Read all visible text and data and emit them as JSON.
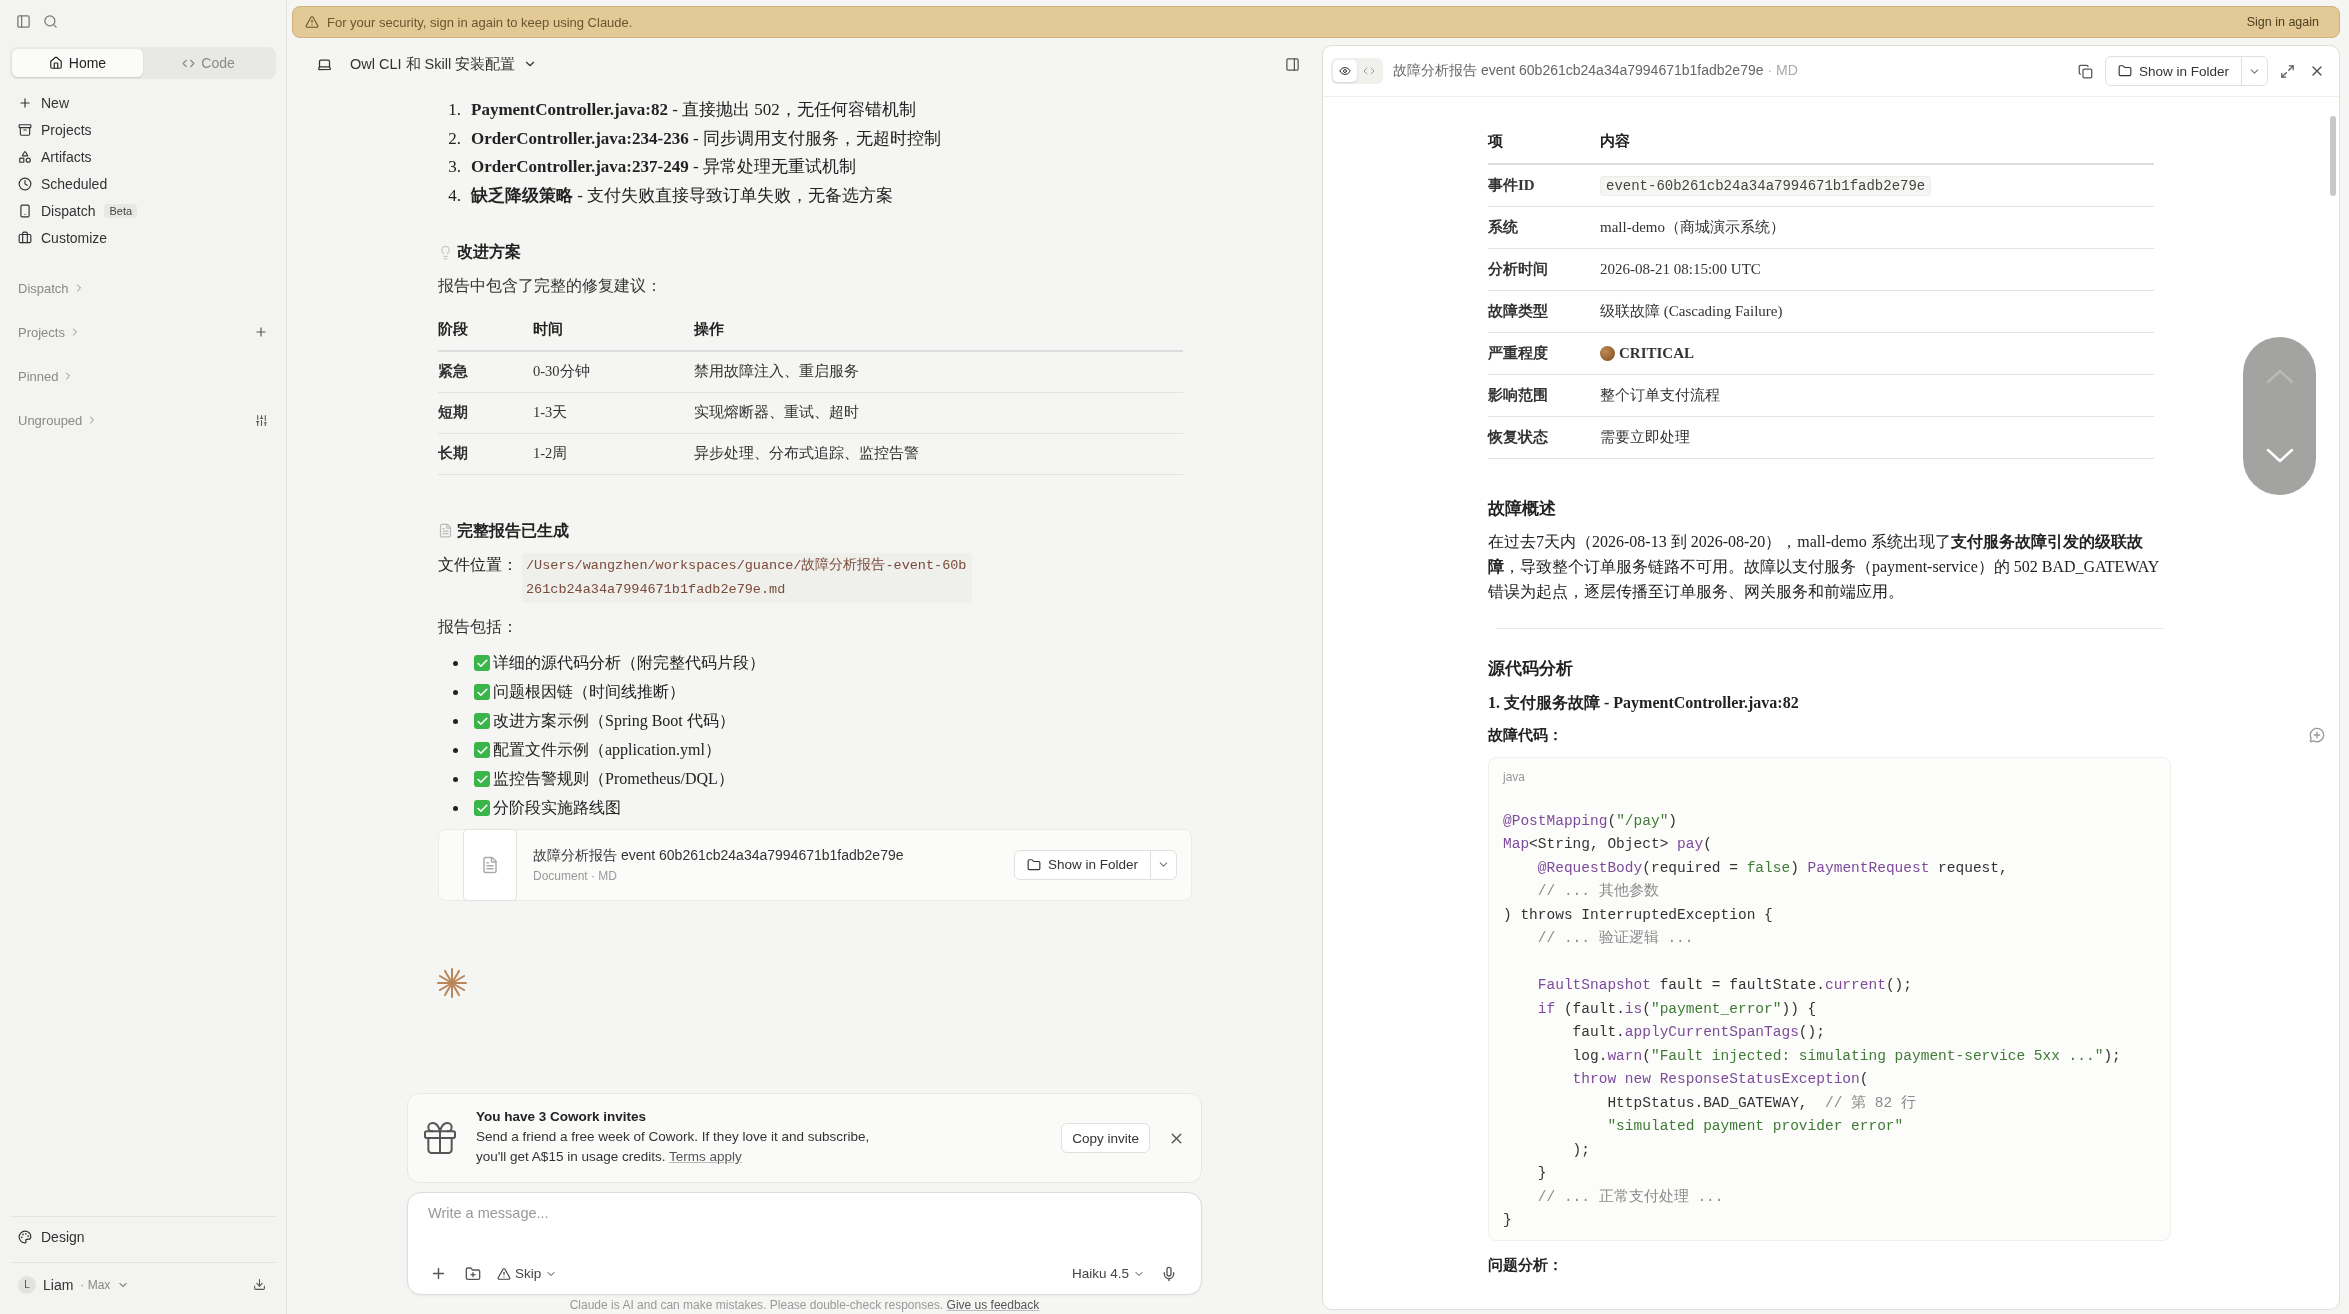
{
  "sidebar": {
    "tabs": [
      {
        "label": "Home",
        "selected": true
      },
      {
        "label": "Code",
        "selected": false
      }
    ],
    "nav": [
      {
        "label": "New"
      },
      {
        "label": "Projects"
      },
      {
        "label": "Artifacts"
      },
      {
        "label": "Scheduled"
      },
      {
        "label": "Dispatch",
        "badge": "Beta"
      },
      {
        "label": "Customize"
      }
    ],
    "sections": [
      {
        "label": "Dispatch",
        "kind": "plain"
      },
      {
        "label": "Projects",
        "kind": "add"
      },
      {
        "label": "Pinned",
        "kind": "plain"
      },
      {
        "label": "Ungrouped",
        "kind": "filter"
      }
    ],
    "bottom": {
      "label": "Design"
    },
    "account": {
      "initial": "L",
      "name": "Liam",
      "plan": "· Max"
    }
  },
  "banner": {
    "message": "For your security, sign in again to keep using Claude.",
    "action": "Sign in again"
  },
  "chat": {
    "title": "Owl CLI 和 Skill 安装配置",
    "issues": [
      {
        "number": "1.",
        "text": "**PaymentController.java:82** - 直接抛出 502，无任何容错机制"
      },
      {
        "number": "2.",
        "text": "**OrderController.java:234-236** - 同步调用支付服务，无超时控制"
      },
      {
        "number": "3.",
        "text": "**OrderController.java:237-249** - 异常处理无重试机制"
      },
      {
        "number": "4.",
        "text": "**缺乏降级策略** - 支付失败直接导致订单失败，无备选方案"
      }
    ],
    "plan_heading": "改进方案",
    "plan_intro": "报告中包含了完整的修复建议：",
    "plan_table": {
      "columns": [
        "阶段",
        "时间",
        "操作"
      ],
      "rows": [
        [
          "紧急",
          "0-30分钟",
          "禁用故障注入、重启服务"
        ],
        [
          "短期",
          "1-3天",
          "实现熔断器、重试、超时"
        ],
        [
          "长期",
          "1-2周",
          "异步处理、分布式追踪、监控告警"
        ]
      ]
    },
    "report_heading": "完整报告已生成",
    "file_label": "文件位置：",
    "file_path": "/Users/wangzhen/workspaces/guance/故障分析报告-event-60b261cb24a34a7994671b1fadb2e79e.md",
    "includes_label": "报告包括：",
    "includes": [
      {
        "text": "详细的源代码分析（附完整代码片段）",
        "checked": true
      },
      {
        "text": "问题根因链（时间线推断）",
        "checked": true
      },
      {
        "text": "改进方案示例（Spring Boot 代码）",
        "checked": true
      },
      {
        "text": "配置文件示例（application.yml）",
        "checked": true
      },
      {
        "text": "监控告警规则（Prometheus/DQL）",
        "checked": true
      },
      {
        "text": "分阶段实施路线图",
        "checked": true
      }
    ],
    "attachment": {
      "title": "故障分析报告 event 60b261cb24a34a7994671b1fadb2e79e",
      "subtitle": "Document · MD",
      "button": "Show in Folder"
    },
    "invite": {
      "title": "You have 3 Cowork invites",
      "text": "Send a friend a free week of Cowork. If they love it and subscribe, you'll get A$15 in usage credits.",
      "link": "Terms apply",
      "button": "Copy invite"
    },
    "composer": {
      "placeholder": "Write a message...",
      "mode": "Skip",
      "model": "Haiku 4.5"
    },
    "disclaimer": {
      "text": "Claude is AI and can make mistakes. Please double-check responses.",
      "link": "Give us feedback"
    }
  },
  "document": {
    "view_modes": [
      {
        "selected": true
      },
      {
        "selected": false
      }
    ],
    "title": "故障分析报告 event 60b261cb24a34a7994671b1fadb2e79e",
    "format": "· MD",
    "button": "Show in Folder",
    "info_table": {
      "columns": [
        "项",
        "内容"
      ],
      "rows": [
        {
          "item": "事件ID",
          "value": "event-60b261cb24a34a7994671b1fadb2e79e",
          "kind": "code"
        },
        {
          "item": "系统",
          "value": "mall-demo（商城演示系统）",
          "kind": "text"
        },
        {
          "item": "分析时间",
          "value": "2026-08-21 08:15:00 UTC",
          "kind": "text"
        },
        {
          "item": "故障类型",
          "value": "级联故障 (Cascading Failure)",
          "kind": "text"
        },
        {
          "item": "严重程度",
          "value": "CRITICAL",
          "kind": "severity"
        },
        {
          "item": "影响范围",
          "value": "整个订单支付流程",
          "kind": "text"
        },
        {
          "item": "恢复状态",
          "value": "需要立即处理",
          "kind": "text"
        }
      ]
    },
    "overview_heading": "故障概述",
    "overview": "在过去7天内（2026-08-13 到 2026-08-20），mall-demo 系统出现了**支付服务故障引发的级联故障**，导致整个订单服务链路不可用。故障以支付服务（payment-service）的 502 BAD_GATEWAY 错误为起点，逐层传播至订单服务、网关服务和前端应用。",
    "source_heading": "源代码分析",
    "finding_title": "1. 支付服务故障 - PaymentController.java:82",
    "code_label": "故障代码：",
    "code": {
      "language": "java",
      "lines": [
        {
          "kind": "code",
          "tokens": [
            {
              "kind": "accent",
              "text": "@PostMapping"
            },
            {
              "kind": "plain",
              "text": "("
            },
            {
              "kind": "string",
              "text": "\"/pay\""
            },
            {
              "kind": "plain",
              "text": ")"
            }
          ]
        },
        {
          "kind": "code",
          "tokens": [
            {
              "kind": "accent",
              "text": "Map"
            },
            {
              "kind": "plain",
              "text": "<String, Object> "
            },
            {
              "kind": "accent",
              "text": "pay"
            },
            {
              "kind": "plain",
              "text": "("
            }
          ]
        },
        {
          "kind": "code",
          "tokens": [
            {
              "kind": "accent",
              "text": "    @RequestBody"
            },
            {
              "kind": "plain",
              "text": "(required = "
            },
            {
              "kind": "string",
              "text": "false"
            },
            {
              "kind": "plain",
              "text": ") "
            },
            {
              "kind": "accent",
              "text": "PaymentRequest"
            },
            {
              "kind": "plain",
              "text": " request,"
            }
          ]
        },
        {
          "kind": "code",
          "tokens": [
            {
              "kind": "comment",
              "text": "    // ... 其他参数"
            }
          ]
        },
        {
          "kind": "code",
          "tokens": [
            {
              "kind": "plain",
              "text": ") throws InterruptedException {"
            }
          ]
        },
        {
          "kind": "code",
          "tokens": [
            {
              "kind": "comment",
              "text": "    // ... 验证逻辑 ..."
            }
          ]
        },
        {
          "kind": "blank"
        },
        {
          "kind": "code",
          "tokens": [
            {
              "kind": "accent",
              "text": "    FaultSnapshot"
            },
            {
              "kind": "plain",
              "text": " fault = faultState."
            },
            {
              "kind": "accent",
              "text": "current"
            },
            {
              "kind": "plain",
              "text": "();"
            }
          ]
        },
        {
          "kind": "code",
          "tokens": [
            {
              "kind": "accent",
              "text": "    if"
            },
            {
              "kind": "plain",
              "text": " (fault."
            },
            {
              "kind": "accent",
              "text": "is"
            },
            {
              "kind": "plain",
              "text": "("
            },
            {
              "kind": "string",
              "text": "\"payment_error\""
            },
            {
              "kind": "plain",
              "text": ")) {"
            }
          ]
        },
        {
          "kind": "code",
          "tokens": [
            {
              "kind": "plain",
              "text": "        fault."
            },
            {
              "kind": "accent",
              "text": "applyCurrentSpanTags"
            },
            {
              "kind": "plain",
              "text": "();"
            }
          ]
        },
        {
          "kind": "code",
          "tokens": [
            {
              "kind": "plain",
              "text": "        log."
            },
            {
              "kind": "accent",
              "text": "warn"
            },
            {
              "kind": "plain",
              "text": "("
            },
            {
              "kind": "string",
              "text": "\"Fault injected: simulating payment-service 5xx ...\""
            },
            {
              "kind": "plain",
              "text": ");"
            }
          ]
        },
        {
          "kind": "code",
          "tokens": [
            {
              "kind": "accent",
              "text": "        throw new ResponseStatusException"
            },
            {
              "kind": "plain",
              "text": "("
            }
          ]
        },
        {
          "kind": "code",
          "tokens": [
            {
              "kind": "plain",
              "text": "            HttpStatus.BAD_GATEWAY,  "
            },
            {
              "kind": "comment",
              "text": "// 第 82 行"
            }
          ]
        },
        {
          "kind": "code",
          "tokens": [
            {
              "kind": "string",
              "text": "            \"simulated payment provider error\""
            }
          ]
        },
        {
          "kind": "code",
          "tokens": [
            {
              "kind": "plain",
              "text": "        );"
            }
          ]
        },
        {
          "kind": "code",
          "tokens": [
            {
              "kind": "plain",
              "text": "    }"
            }
          ]
        },
        {
          "kind": "code",
          "tokens": [
            {
              "kind": "comment",
              "text": "    // ... 正常支付处理 ..."
            }
          ]
        },
        {
          "kind": "code",
          "tokens": [
            {
              "kind": "plain",
              "text": "}"
            }
          ]
        }
      ]
    },
    "analysis_label": "问题分析："
  }
}
